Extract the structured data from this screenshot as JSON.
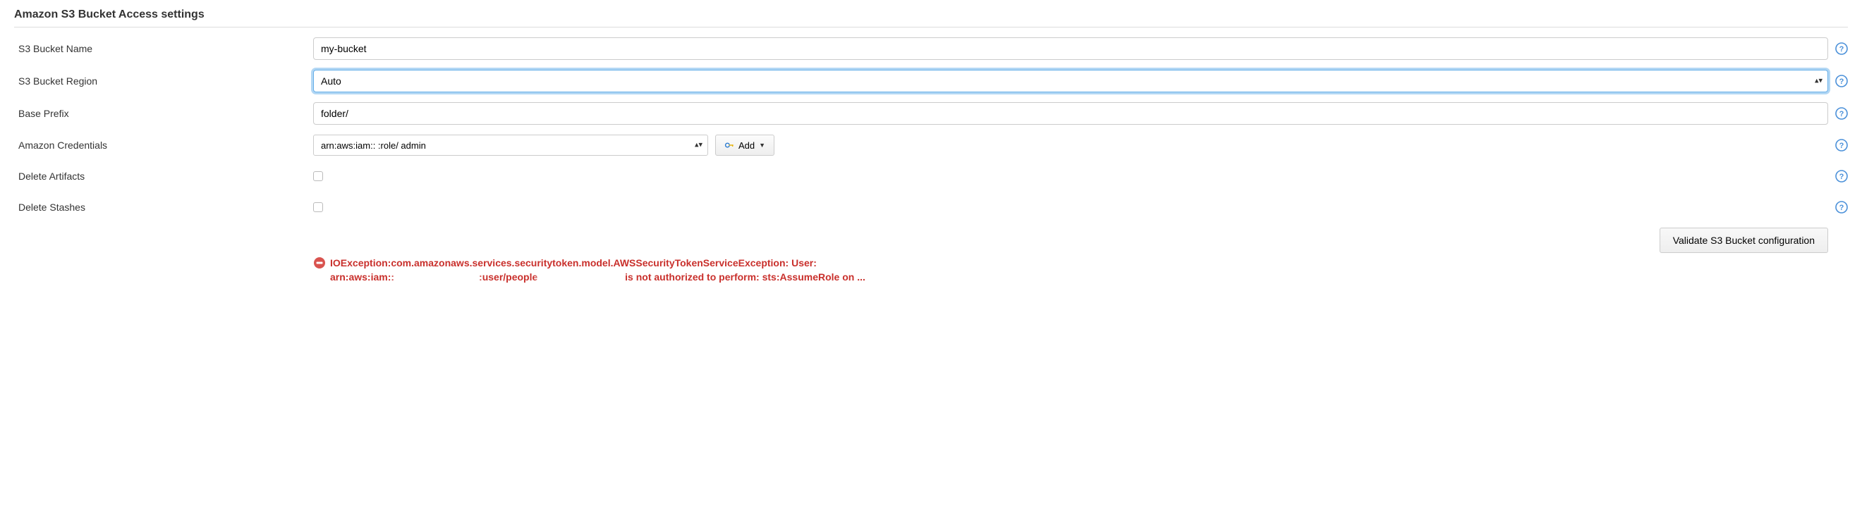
{
  "section_title": "Amazon S3 Bucket Access settings",
  "fields": {
    "bucket_name": {
      "label": "S3 Bucket Name",
      "value": "my-bucket"
    },
    "bucket_region": {
      "label": "S3 Bucket Region",
      "value": "Auto"
    },
    "base_prefix": {
      "label": "Base Prefix",
      "value": "folder/"
    },
    "credentials": {
      "label": "Amazon Credentials",
      "value": "arn:aws:iam:: :role/ admin"
    },
    "delete_artifacts": {
      "label": "Delete Artifacts",
      "checked": false
    },
    "delete_stashes": {
      "label": "Delete Stashes",
      "checked": false
    }
  },
  "buttons": {
    "add": "Add",
    "validate": "Validate S3 Bucket configuration"
  },
  "error": {
    "line1": "IOException:com.amazonaws.services.securitytoken.model.AWSSecurityTokenServiceException: User:",
    "line2a": "arn:aws:iam::",
    "line2b": ":user/people",
    "line2c": " is not authorized to perform: sts:AssumeRole on ..."
  }
}
